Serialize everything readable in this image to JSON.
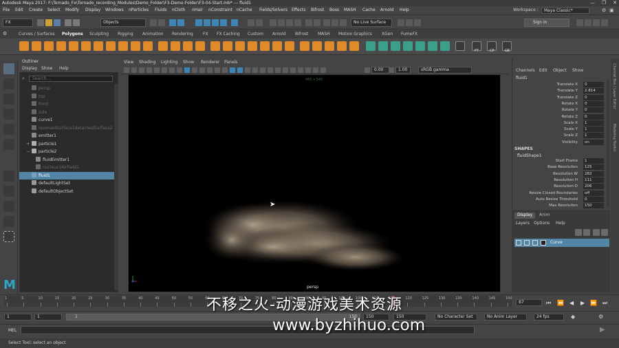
{
  "window": {
    "title": "Autodesk Maya 2017: F:\\Tornado_Fx\\Tornado_recording_Modules\\Demo_Folder\\F3-Demo-Folder\\F3-04-Start.mb* --- fluid1",
    "controls": [
      "—",
      "❐",
      "✕"
    ]
  },
  "menubar": {
    "items": [
      "File",
      "Edit",
      "Create",
      "Select",
      "Modify",
      "Display",
      "Windows",
      "nParticles",
      "Fluids",
      "nCloth",
      "nHair",
      "nConstraint",
      "nCache",
      "Fields/Solvers",
      "Effects",
      "Bifrost",
      "Boss",
      "MASH",
      "Cache",
      "Arnold",
      "Help"
    ],
    "workspace_label": "Workspace :",
    "workspace_value": "Maya Classic*"
  },
  "statusline": {
    "menuset": "FX",
    "selection_mode": "Objects",
    "live_surface": "No Live Surface",
    "sign_in": "Sign In"
  },
  "shelf": {
    "tabs": [
      "Curves / Surfaces",
      "Polygons",
      "Sculpting",
      "Rigging",
      "Animation",
      "Rendering",
      "FX",
      "FX Caching",
      "Custom",
      "Arnold",
      "Bifrost",
      "MASH",
      "Motion Graphics",
      "XGen",
      "FumeFX"
    ],
    "active_tab": "Polygons",
    "icon_labels": [
      "FT",
      "CP",
      "GE"
    ]
  },
  "outliner": {
    "title": "Outliner",
    "menu": [
      "Display",
      "Show",
      "Help"
    ],
    "search_placeholder": "Search...",
    "items": [
      {
        "label": "persp",
        "dim": true,
        "expand": ""
      },
      {
        "label": "top",
        "dim": true,
        "expand": ""
      },
      {
        "label": "front",
        "dim": true,
        "expand": ""
      },
      {
        "label": "side",
        "dim": true,
        "expand": ""
      },
      {
        "label": "curve1",
        "dim": false,
        "expand": ""
      },
      {
        "label": "revolvedSurface1detachedSurface2",
        "dim": true,
        "expand": ""
      },
      {
        "label": "emitter1",
        "dim": false,
        "expand": ""
      },
      {
        "label": "particle1",
        "dim": false,
        "expand": "+"
      },
      {
        "label": "particle2",
        "dim": false,
        "expand": "−"
      },
      {
        "label": "fluidEmitter1",
        "dim": false,
        "expand": ""
      },
      {
        "label": "nucleus1AirField1",
        "dim": true,
        "expand": ""
      },
      {
        "label": "fluid1",
        "dim": false,
        "expand": "",
        "selected": true
      },
      {
        "label": "defaultLightSet",
        "dim": false,
        "expand": ""
      },
      {
        "label": "defaultObjectSet",
        "dim": false,
        "expand": ""
      }
    ]
  },
  "viewport": {
    "menu": [
      "View",
      "Shading",
      "Lighting",
      "Show",
      "Renderer",
      "Panels"
    ],
    "exposure": "0.00",
    "gamma": "1.00",
    "color_space": "sRGB gamma",
    "resolution_gate": "960 x 540",
    "camera": "persp"
  },
  "channelbox": {
    "menu": [
      "Channels",
      "Edit",
      "Object",
      "Show"
    ],
    "node": "fluid1",
    "attributes": [
      {
        "label": "Translate X",
        "value": "0"
      },
      {
        "label": "Translate Y",
        "value": "2.814"
      },
      {
        "label": "Translate Z",
        "value": "0"
      },
      {
        "label": "Rotate X",
        "value": "0"
      },
      {
        "label": "Rotate Y",
        "value": "0"
      },
      {
        "label": "Rotate Z",
        "value": "0"
      },
      {
        "label": "Scale X",
        "value": "1"
      },
      {
        "label": "Scale Y",
        "value": "1"
      },
      {
        "label": "Scale Z",
        "value": "1"
      },
      {
        "label": "Visibility",
        "value": "on"
      }
    ],
    "shapes_header": "SHAPES",
    "shape_node": "fluidShape1",
    "shape_attributes": [
      {
        "label": "Start Frame",
        "value": "1"
      },
      {
        "label": "Base Resolution",
        "value": "125"
      },
      {
        "label": "Resolution W",
        "value": "282"
      },
      {
        "label": "Resolution H",
        "value": "111"
      },
      {
        "label": "Resolution D",
        "value": "206"
      },
      {
        "label": "Resize Closed Boundaries",
        "value": "off"
      },
      {
        "label": "Auto Resize Threshold",
        "value": "0"
      },
      {
        "label": "Max Resolution",
        "value": "150"
      }
    ]
  },
  "layers": {
    "tabs": [
      "Display",
      "Anim"
    ],
    "menu": [
      "Layers",
      "Options",
      "Help"
    ],
    "layer_name": "Curve"
  },
  "right_tabs": [
    "Channel Box / Layer Editor",
    "Modeling Toolkit"
  ],
  "timeline": {
    "ticks": [
      "1",
      "5",
      "10",
      "15",
      "20",
      "25",
      "30",
      "35",
      "40",
      "45",
      "50",
      "55",
      "60",
      "65",
      "70",
      "75",
      "80",
      "85",
      "90",
      "95",
      "100",
      "105",
      "110",
      "115",
      "120",
      "125",
      "130",
      "135",
      "140",
      "145",
      "150"
    ],
    "current_frame": "87",
    "playback": [
      "⏮",
      "⏪",
      "◀",
      "▶",
      "⏩",
      "⏭"
    ]
  },
  "range": {
    "start": "1",
    "start_inner": "1",
    "range_start_label": "1",
    "range_end_label": "150",
    "end_inner": "150",
    "end": "150",
    "character_set": "No Character Set",
    "anim_layer": "No Anim Layer",
    "fps": "24 fps"
  },
  "cmdline": {
    "label": "MEL"
  },
  "helpline": {
    "text": "Select Tool: select an object"
  },
  "watermark": {
    "chinese": "不移之火-动漫游戏美术资源",
    "url": "www.byzhihuo.com"
  },
  "logo": "M",
  "colors": {
    "selection_blue": "#5285a6",
    "shelf_orange": "#e08a2c",
    "shelf_teal": "#3aa08a",
    "maya_blue": "#2aa7c9"
  }
}
